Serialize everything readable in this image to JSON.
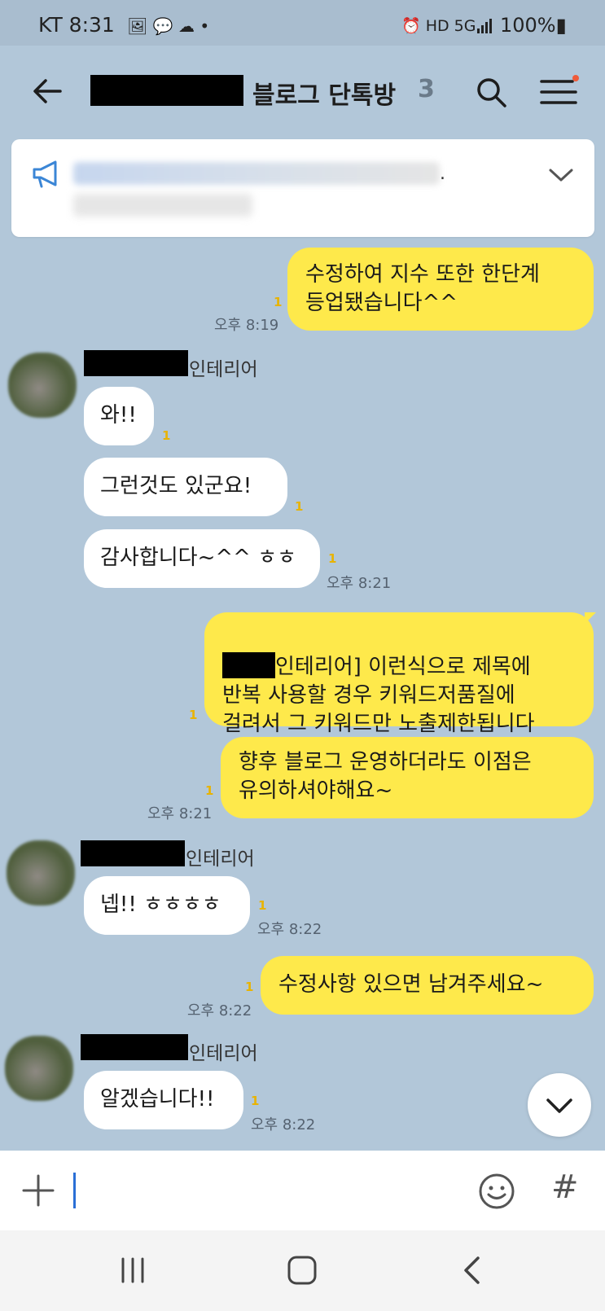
{
  "status_bar": {
    "carrier_time": "KT  8:31",
    "left_icons": "🖼 💬 ☁ •",
    "right_icons": "⏰ HD 5G ",
    "battery": "100%▮"
  },
  "header": {
    "title": "블로그 단톡방",
    "member_count": "3"
  },
  "notice": {
    "trailing": "."
  },
  "messages": {
    "m1": {
      "text": "수정하여 지수 또한 한단계\n등업됐습니다^^",
      "unread": "1",
      "time": "오후 8:19"
    },
    "sender1": "인테리어",
    "m2": {
      "text": "와!!",
      "unread": "1"
    },
    "m3": {
      "text": "그런것도 있군요!",
      "unread": "1"
    },
    "m4": {
      "text": "감사합니다~^^ ㅎㅎ",
      "unread": "1",
      "time": "오후 8:21"
    },
    "m5": {
      "text_line1": "인테리어] 이런식으로 제목에",
      "text_rest": "반복 사용할 경우 키워드저품질에\n걸려서 그 키워드만 노출제한됩니다",
      "unread": "1"
    },
    "m6": {
      "text": "향후 블로그 운영하더라도 이점은\n유의하셔야해요~",
      "unread": "1",
      "time": "오후 8:21"
    },
    "sender2": "인테리어",
    "m7": {
      "text": "넵!! ㅎㅎㅎㅎ",
      "unread": "1",
      "time": "오후 8:22"
    },
    "m8": {
      "text": "수정사항 있으면 남겨주세요~",
      "unread": "1",
      "time": "오후 8:22"
    },
    "sender3": "인테리어",
    "m9": {
      "text": "알겠습니다!!",
      "unread": "1",
      "time": "오후 8:22"
    }
  },
  "input": {
    "hash": "#"
  }
}
